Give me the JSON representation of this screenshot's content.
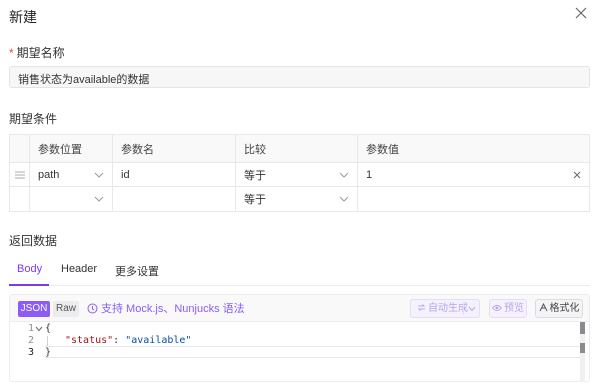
{
  "dialog": {
    "title": "新建"
  },
  "name_field": {
    "required_mark": "*",
    "label": "期望名称",
    "value": "销售状态为available的数据"
  },
  "conditions": {
    "label": "期望条件",
    "columns": [
      "参数位置",
      "参数名",
      "比较",
      "参数值"
    ],
    "rows": [
      {
        "position": "path",
        "name": "id",
        "compare": "等于",
        "value": "1"
      },
      {
        "position": "",
        "name": "",
        "compare": "等于",
        "value": ""
      }
    ]
  },
  "response": {
    "label": "返回数据",
    "tabs": [
      "Body",
      "Header",
      "更多设置"
    ],
    "active_tab": "Body"
  },
  "editor": {
    "mode_json": "JSON",
    "mode_raw": "Raw",
    "mock_text": "支持 Mock.js、Nunjucks 语法",
    "auto_generate": "自动生成",
    "preview": "预览",
    "format": "格式化",
    "line_numbers": [
      "1",
      "2",
      "3"
    ],
    "code_open": "{",
    "code_key": "\"status\"",
    "code_colon": ": ",
    "code_value": "\"available\"",
    "code_close": "}"
  },
  "colors": {
    "accent": "#7c3aed",
    "required": "#e34d4d"
  },
  "icons": [
    "close-icon",
    "drag-handle-icon",
    "chevron-down-icon",
    "clear-icon",
    "help-circle-icon",
    "sync-icon",
    "eye-icon",
    "format-icon"
  ]
}
